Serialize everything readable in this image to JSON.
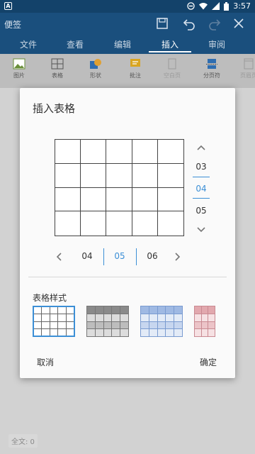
{
  "status_bar": {
    "time": "3:57",
    "app_badge": "A"
  },
  "app": {
    "doc_title": "便签"
  },
  "tabs": [
    {
      "label": "文件"
    },
    {
      "label": "查看"
    },
    {
      "label": "编辑"
    },
    {
      "label": "插入"
    },
    {
      "label": "审阅"
    }
  ],
  "active_tab": "插入",
  "ribbon": [
    {
      "label": "图片",
      "icon": "picture-icon"
    },
    {
      "label": "表格",
      "icon": "table-icon"
    },
    {
      "label": "形状",
      "icon": "shape-icon"
    },
    {
      "label": "批注",
      "icon": "comment-icon"
    },
    {
      "label": "空白页",
      "icon": "blank-page-icon"
    },
    {
      "label": "分页符",
      "icon": "page-break-icon"
    },
    {
      "label": "页眉页",
      "icon": "header-footer-icon"
    }
  ],
  "dialog": {
    "title": "插入表格",
    "preview": {
      "rows": 4,
      "cols": 5
    },
    "row_picker": {
      "prev": "03",
      "selected": "04",
      "next": "05"
    },
    "col_picker": {
      "prev": "04",
      "selected": "05",
      "next": "06"
    },
    "style_label": "表格样式",
    "cancel_label": "取消",
    "ok_label": "确定"
  },
  "footer": {
    "word_count": "全文: 0"
  },
  "colors": {
    "accent": "#3c8fd6",
    "title_bar": "#1a4f7d",
    "status_bar": "#13426a"
  }
}
